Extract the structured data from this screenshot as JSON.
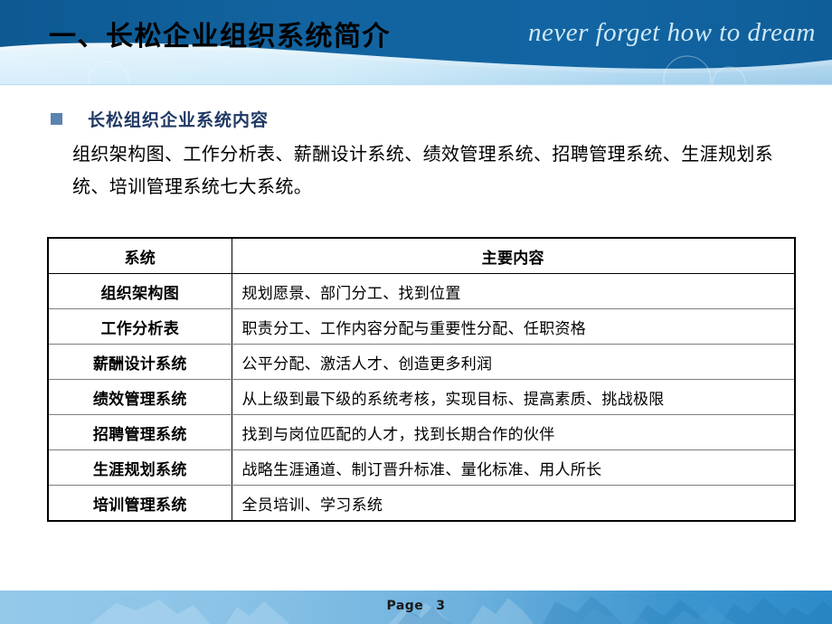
{
  "header": {
    "title": "一、长松企业组织系统简介",
    "tagline": "never forget   how to dream",
    "band_color": "#10609e",
    "band_light_color": "#cfeaf7"
  },
  "content": {
    "bullet_heading": "长松组织企业系统内容",
    "bullet_color": "#5b84b1",
    "heading_color": "#1f3864",
    "paragraph": "组织架构图、工作分析表、薪酬设计系统、绩效管理系统、招聘管理系统、生涯规划系统、培训管理系统七大系统。"
  },
  "table": {
    "columns": [
      "系统",
      "主要内容"
    ],
    "rows": [
      {
        "system": "组织架构图",
        "content": "规划愿景、部门分工、找到位置"
      },
      {
        "system": "工作分析表",
        "content": "职责分工、工作内容分配与重要性分配、任职资格"
      },
      {
        "system": "薪酬设计系统",
        "content": "公平分配、激活人才、创造更多利润"
      },
      {
        "system": "绩效管理系统",
        "content": "从上级到最下级的系统考核，实现目标、提高素质、挑战极限"
      },
      {
        "system": "招聘管理系统",
        "content": "找到与岗位匹配的人才，找到长期合作的伙伴"
      },
      {
        "system": "生涯规划系统",
        "content": "战略生涯通道、制订晋升标准、量化标准、用人所长"
      },
      {
        "system": "培训管理系统",
        "content": "全员培训、学习系统"
      }
    ]
  },
  "footer": {
    "page_label": "Page",
    "page_number": "3",
    "band_color_left": "#8fc5e8",
    "band_color_right": "#2f8ccb"
  }
}
